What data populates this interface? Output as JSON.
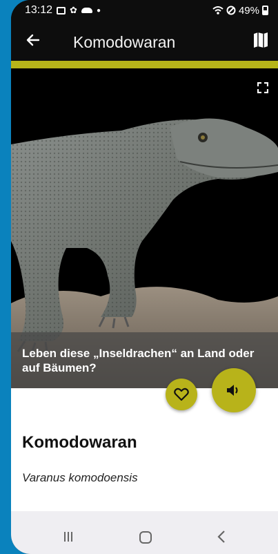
{
  "status_bar": {
    "time": "13:12",
    "battery": "49%",
    "icons": [
      "image-icon",
      "gear-icon",
      "cloud-icon",
      "dot-icon",
      "wifi-icon",
      "dnd-icon",
      "battery-icon"
    ]
  },
  "app_bar": {
    "title": "Komodowaran",
    "icons": [
      "back-arrow-icon",
      "map-icon"
    ]
  },
  "hero": {
    "caption": "Leben diese „Inseldrachen“ an Land oder auf Bäumen?",
    "icons": [
      "fullscreen-icon"
    ]
  },
  "actions": {
    "favorite_icon": "heart-outline-icon",
    "sound_icon": "speaker-icon"
  },
  "details": {
    "name": "Komodowaran",
    "latin": "Varanus komodoensis"
  },
  "nav": {
    "icons": [
      "recent-apps-icon",
      "home-icon",
      "back-icon"
    ]
  },
  "colors": {
    "accent": "#b8b31a",
    "frame": "#0a82bd",
    "bar": "#0d0d0d"
  }
}
